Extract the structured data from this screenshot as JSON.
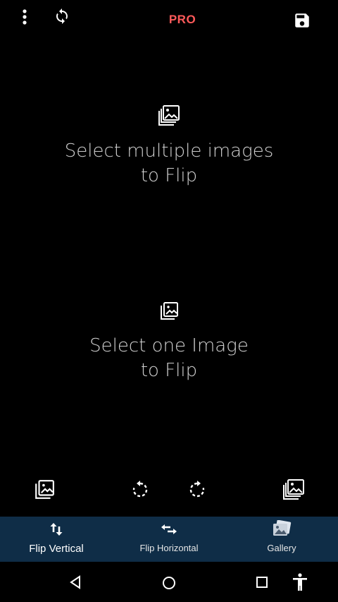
{
  "topbar": {
    "menu_icon": "more-vert-icon",
    "sync_icon": "sync-icon",
    "pro_label": "PRO",
    "save_icon": "save-icon"
  },
  "main": {
    "multi_icon": "photo-library-icon",
    "multi_prompt_line1": "Select multiple images",
    "multi_prompt_line2": "to Flip",
    "single_icon": "photo-icon",
    "single_prompt_line1": "Select one Image",
    "single_prompt_line2": "to Flip"
  },
  "action_row": {
    "icons": [
      "photo-icon",
      "rotate-left-icon",
      "rotate-right-icon",
      "photo-library-icon"
    ]
  },
  "bottom_nav": {
    "items": [
      {
        "label": "Flip Vertical",
        "icon": "swap-vert-icon",
        "active": true
      },
      {
        "label": "Flip Horizontal",
        "icon": "swap-horiz-icon",
        "active": false
      },
      {
        "label": "Gallery",
        "icon": "gallery-icon",
        "active": false
      }
    ],
    "background": "#0f2d47"
  },
  "system_nav": {
    "icons": [
      "back-icon",
      "home-icon",
      "recents-icon",
      "accessibility-icon"
    ]
  },
  "colors": {
    "accent_pro": "#ff5a5a",
    "background": "#000000",
    "text": "#cfcfcf"
  }
}
